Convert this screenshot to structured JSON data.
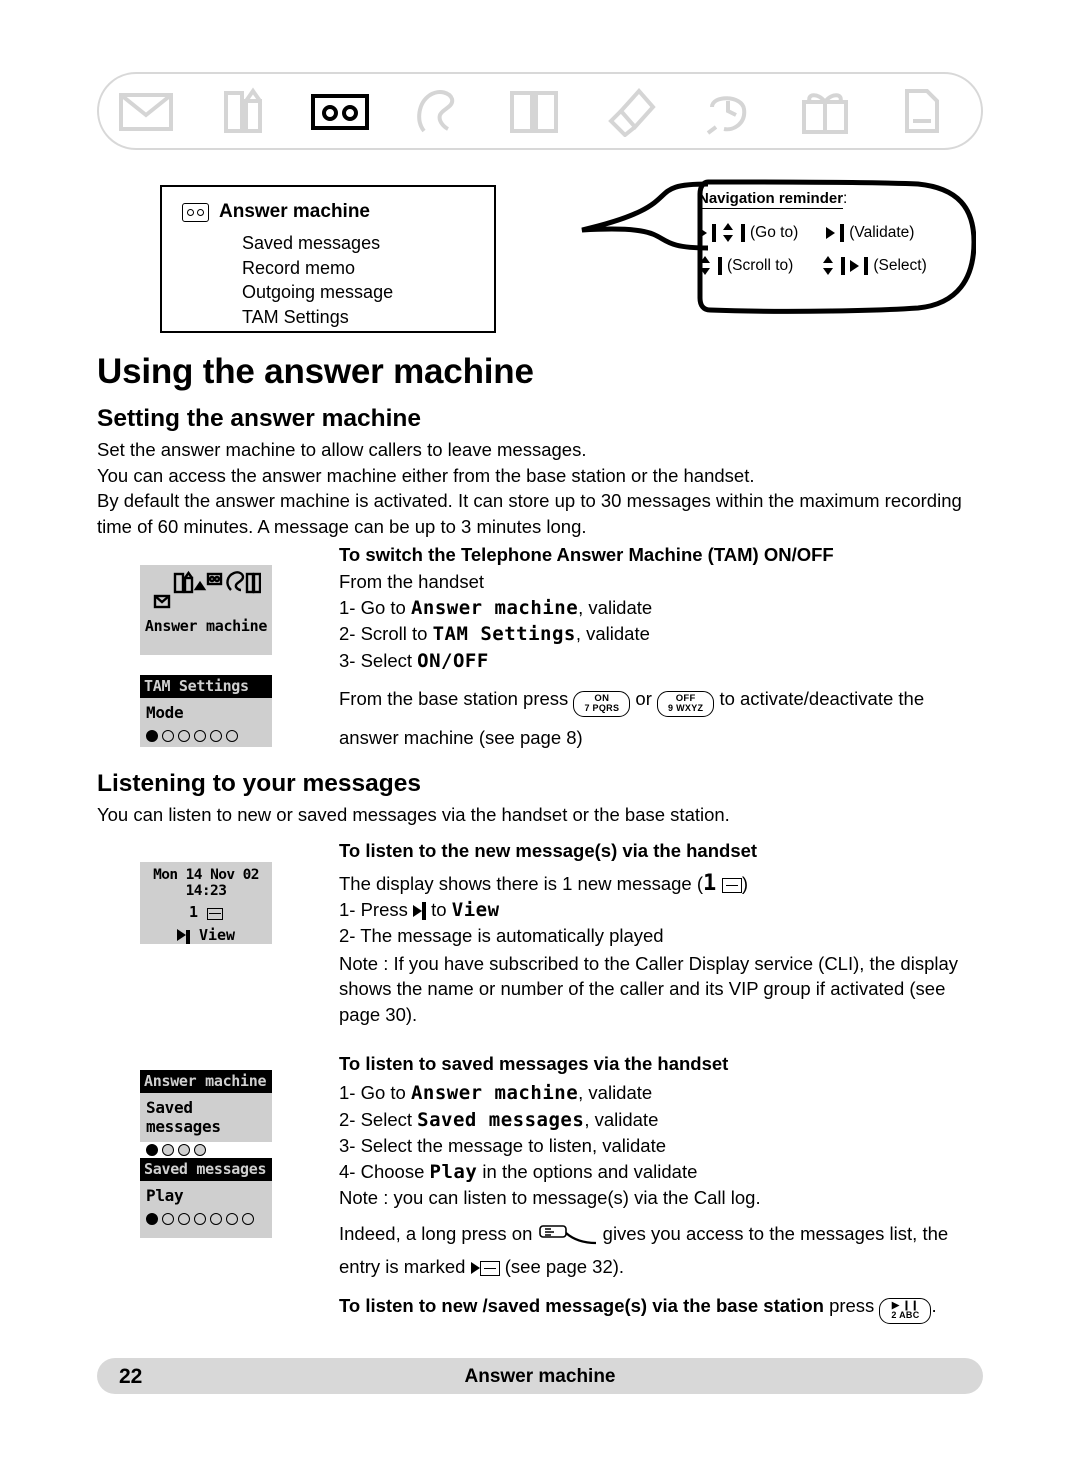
{
  "icon_bar": {
    "icons": [
      {
        "name": "envelope-icon",
        "active": false
      },
      {
        "name": "phonebook-icon",
        "active": false
      },
      {
        "name": "answer-machine-tape-icon",
        "active": true
      },
      {
        "name": "call-log-icon",
        "active": false
      },
      {
        "name": "open-book-icon",
        "active": false
      },
      {
        "name": "ringtones-icon",
        "active": false
      },
      {
        "name": "alarm-clock-icon",
        "active": false
      },
      {
        "name": "gift-box-icon",
        "active": false
      },
      {
        "name": "base-settings-icon",
        "active": false
      }
    ]
  },
  "menu_box": {
    "title": "Answer machine",
    "items": [
      "Saved messages",
      "Record memo",
      "Outgoing message",
      "TAM Settings"
    ]
  },
  "callout": {
    "title": "Navigation reminder",
    "title_suffix": ":",
    "rows": [
      {
        "label_1": "(Go to)",
        "label_2": "(Validate)"
      },
      {
        "label_1": "(Scroll to)",
        "label_2": "(Select)"
      }
    ]
  },
  "page": {
    "title": "Using the answer machine",
    "section_1_title": "Setting the answer machine",
    "intro_lines": [
      "Set the answer machine to allow callers to leave messages.",
      "You can access the answer machine either from the base station or the handset.",
      "By default the answer machine is activated. It can store up to 30 messages within the maximum recording time of 60 minutes. A message can be up to 3 minutes long."
    ],
    "section_2_title": "Listening to your messages",
    "listen_intro": "You can listen to new or saved messages via the handset or the base station."
  },
  "tam_onoff": {
    "heading": "To switch the Telephone Answer Machine (TAM) ON/OFF",
    "line_from": "From the handset",
    "step1_pre": "1- Go to",
    "step1_lcd": "Answer machine",
    "step1_post": ", validate",
    "step2_pre": "2- Scroll to",
    "step2_lcd": "TAM Settings",
    "step2_post": ", validate",
    "step3_pre": "3- Select",
    "step3_lcd": "ON/OFF",
    "base_pre": "From the base station press",
    "base_key_1_top": "ON",
    "base_key_1_bottom": "7 PQRS",
    "base_or": "or",
    "base_key_2_top": "OFF",
    "base_key_2_bottom": "9 WXYZ",
    "base_post": "to activate/deactivate the",
    "base_post_2": "answer machine (see page 8)"
  },
  "new_messages": {
    "heading": "To listen to the new message(s) via the handset",
    "line1_pre": "The display shows there is 1 new message (",
    "line1_count": "1",
    "line1_post": ")",
    "step1_pre": "1- Press",
    "step1_mid": "to",
    "step1_lcd": "View",
    "step2": "2- The message is automatically played",
    "note": "Note : If you have subscribed to the Caller Display service (CLI), the display shows the name or number of the caller and its VIP group if activated (see page 30)."
  },
  "saved_messages": {
    "heading": "To listen to saved messages via the handset",
    "step1_pre": "1- Go to",
    "step1_lcd": "Answer machine",
    "step1_post": ", validate",
    "step2_pre": "2- Select",
    "step2_lcd": "Saved messages",
    "step2_post": ", validate",
    "step3": "3- Select the message to listen, validate",
    "step4_pre": "4- Choose",
    "step4_lcd": "Play",
    "step4_post": "in the options and validate",
    "note": "Note : you can listen to message(s) via the Call log.",
    "indeed_pre": "Indeed, a long press on",
    "indeed_post": "gives you access to the messages list, the",
    "entry_pre": "entry is marked",
    "entry_post": "(see page 32)."
  },
  "base_station_listen": {
    "heading": "To listen to new /saved message(s) via the base station",
    "press_word": "press",
    "key_top": "▶ ❙❙",
    "key_bottom": "2 ABC",
    "period": "."
  },
  "lcd_menu": {
    "label": "Answer machine"
  },
  "lcd_tam_settings": {
    "title": "TAM Settings",
    "row": "Mode",
    "dots_total": 6,
    "dots_filled": 1
  },
  "lcd_monitor": {
    "line1": "Mon  14 Nov 02 14:23",
    "line2_count": "1",
    "line3": "View"
  },
  "lcd_answer_machine": {
    "title": "Answer machine",
    "row": "Saved messages",
    "dots_total": 4,
    "dots_filled": 1
  },
  "lcd_saved_messages": {
    "title": "Saved messages",
    "row": "Play",
    "dots_total": 7,
    "dots_filled": 1
  },
  "footer": {
    "page_number": "22",
    "title": "Answer machine"
  }
}
